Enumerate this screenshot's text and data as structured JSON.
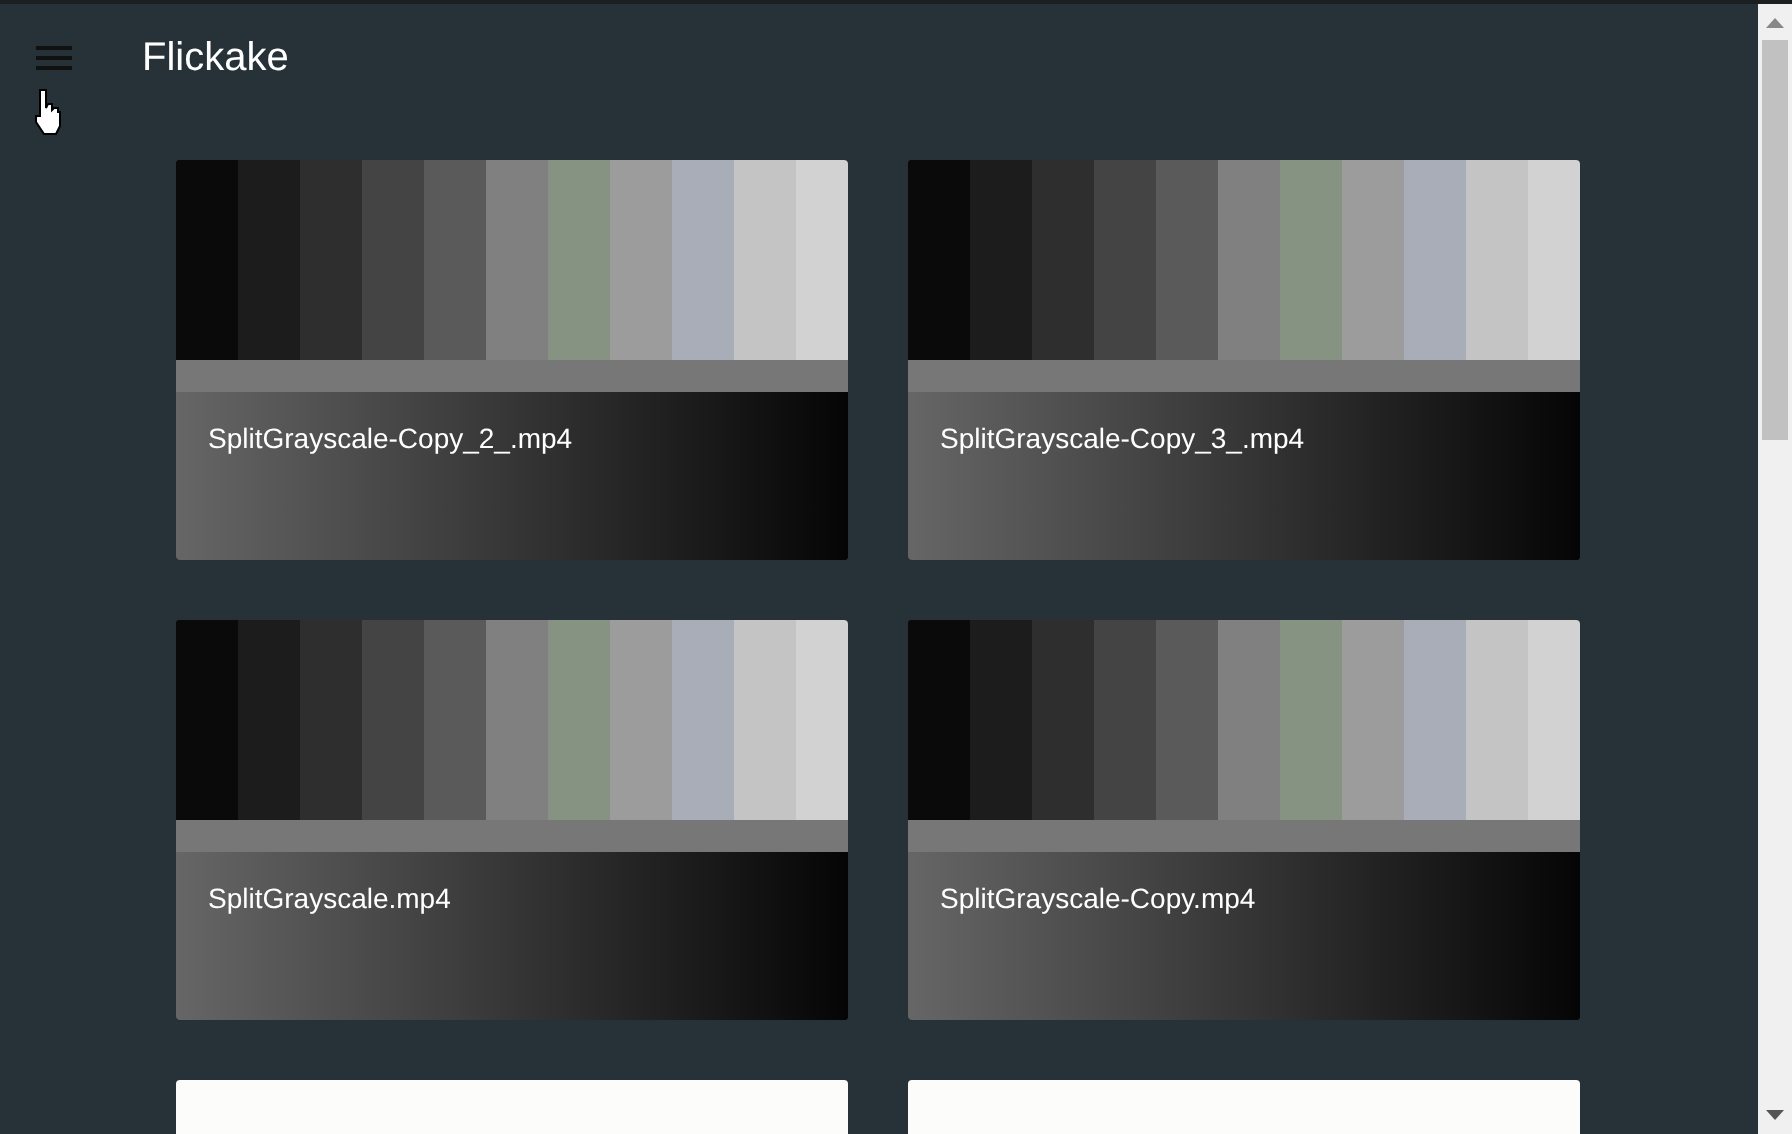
{
  "app_bar": {
    "title": "Flickake"
  },
  "videos": [
    {
      "kind": "video",
      "name": "SplitGrayscale-Copy_2_.mp4"
    },
    {
      "kind": "video",
      "name": "SplitGrayscale-Copy_3_.mp4"
    },
    {
      "kind": "video",
      "name": "SplitGrayscale.mp4"
    },
    {
      "kind": "video",
      "name": "SplitGrayscale-Copy.mp4"
    },
    {
      "kind": "blank"
    },
    {
      "kind": "blank"
    }
  ]
}
